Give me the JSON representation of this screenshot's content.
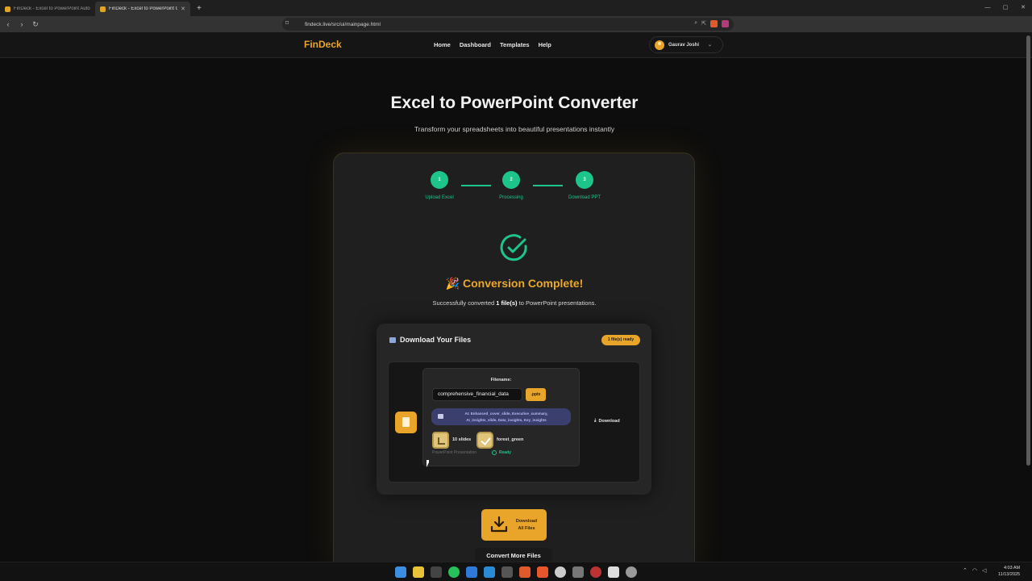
{
  "browser": {
    "tabs": [
      {
        "label": "FinDeck - Excel to PowerPoint Autom"
      },
      {
        "label": "FinDeck - Excel to PowerPoint Co"
      }
    ],
    "url": "findeck.live/src/ui/mainpage.html"
  },
  "nav": {
    "brand": "FinDeck",
    "links": [
      "Home",
      "Dashboard",
      "Templates",
      "Help"
    ],
    "user_name": "Gaurav Joshi"
  },
  "hero": {
    "title": "Excel to PowerPoint Converter",
    "subtitle": "Transform your spreadsheets into beautiful presentations instantly"
  },
  "steps": [
    {
      "num": "1",
      "label": "Upload Excel"
    },
    {
      "num": "2",
      "label": "Processing"
    },
    {
      "num": "3",
      "label": "Download PPT"
    }
  ],
  "result": {
    "title": "🎉 Conversion Complete!",
    "sub_prefix": "Successfully converted ",
    "sub_bold": "1 file(s)",
    "sub_suffix": " to PowerPoint presentations."
  },
  "downloads": {
    "heading": "Download Your Files",
    "badge": "1 file(s) ready",
    "file": {
      "filename_label": "Filename:",
      "filename": "comprehensive_financial_data",
      "extension": ".pptx",
      "ai_features_line1": "AI: Enhanced_cover_slide, Executive_summary,",
      "ai_features_line2": "AI_insights_slide, Data_insights, Key_insights",
      "slides": "10 slides",
      "theme": "forest_green",
      "type": "PowerPoint Presentation",
      "status": "Ready",
      "download_label": "Download"
    },
    "download_all_line1": "Download",
    "download_all_line2": "All Files",
    "convert_more": "Convert More Files"
  },
  "taskbar": {
    "time": "4:03 AM",
    "date": "11/13/2025"
  },
  "colors": {
    "accent": "#e8a52a",
    "success": "#1ec58a",
    "background": "#0d0d0d"
  }
}
